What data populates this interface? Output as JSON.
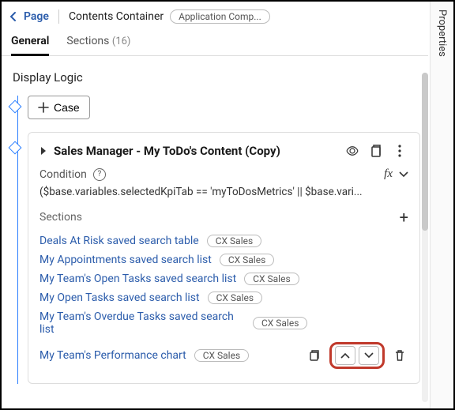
{
  "breadcrumb": {
    "page_label": "Page",
    "container_label": "Contents Container",
    "chip": "Application Comp..."
  },
  "tabs": {
    "general": "General",
    "sections": "Sections",
    "sections_count": "(16)"
  },
  "properties_rail": "Properties",
  "display_logic_title": "Display Logic",
  "case_button": "Case",
  "card": {
    "title": "Sales Manager - My ToDo's Content (Copy)",
    "condition_label": "Condition",
    "fx_label": "fx",
    "condition_expr": "($base.variables.selectedKpiTab == 'myToDosMetrics' || $base.vari...",
    "sections_label": "Sections",
    "items": [
      {
        "label": "Deals At Risk saved search table",
        "tag": "CX Sales"
      },
      {
        "label": "My Appointments saved search list",
        "tag": "CX Sales"
      },
      {
        "label": "My Team's Open Tasks saved search list",
        "tag": "CX Sales"
      },
      {
        "label": "My Open Tasks saved search list",
        "tag": "CX Sales"
      },
      {
        "label": "My Team's Overdue Tasks saved search list",
        "tag": "CX Sales"
      },
      {
        "label": "My Team's Performance chart",
        "tag": "CX Sales"
      }
    ]
  }
}
